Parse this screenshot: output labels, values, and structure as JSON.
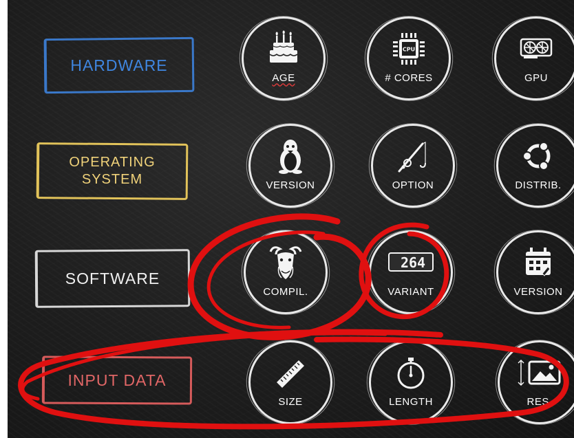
{
  "categories": {
    "hardware": {
      "label": "Hardware"
    },
    "os": {
      "line1": "Operating",
      "line2": "System"
    },
    "software": {
      "label": "Software"
    },
    "input": {
      "label": "Input Data"
    }
  },
  "icons": {
    "age": {
      "label": "Age",
      "icon": "birthday-cake-icon"
    },
    "cores": {
      "label": "# Cores",
      "icon": "cpu-chip-icon",
      "chip_text": "CPU"
    },
    "gpu": {
      "label": "GPU",
      "icon": "graphics-card-icon"
    },
    "os_version": {
      "label": "Version",
      "icon": "tux-penguin-icon"
    },
    "option": {
      "label": "Option",
      "icon": "fishing-rod-icon"
    },
    "distrib": {
      "label": "Distrib.",
      "icon": "ubuntu-logo-icon"
    },
    "compil": {
      "label": "Compil.",
      "icon": "gnu-head-icon"
    },
    "variant": {
      "label": "Variant",
      "icon": "x264-badge-icon",
      "badge_text": "264"
    },
    "sw_version": {
      "label": "Version",
      "icon": "calendar-icon"
    },
    "size": {
      "label": "Size",
      "icon": "ruler-icon"
    },
    "length": {
      "label": "Length",
      "icon": "stopwatch-icon"
    },
    "res": {
      "label": "Res.",
      "icon": "image-resolution-icon"
    }
  },
  "colors": {
    "hardware": "#3f86e0",
    "os": "#f0d27a",
    "software": "#f0f0f0",
    "input": "#e06666",
    "annotation": "#e01010"
  }
}
